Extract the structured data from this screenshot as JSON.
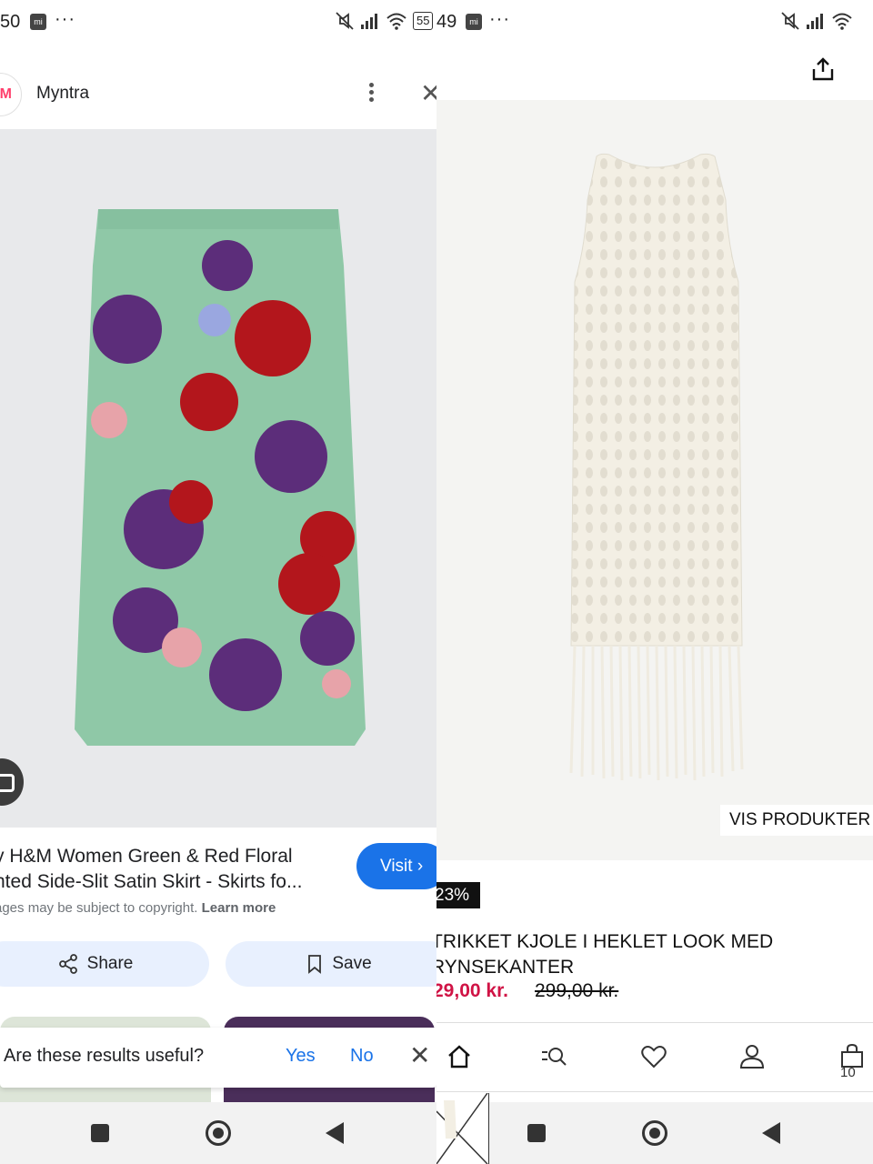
{
  "left": {
    "status": {
      "time": "50",
      "mi_badge": "mi",
      "dots": "···",
      "battery": "55"
    },
    "header": {
      "site_name": "Myntra",
      "site_logo": "M"
    },
    "result": {
      "title_line1": "y H&M Women Green & Red Floral",
      "title_line2": "nted Side-Slit Satin Skirt - Skirts fo...",
      "visit_label": "Visit",
      "copyright_text": "ages may be subject to copyright.",
      "learn_more": "Learn more"
    },
    "actions": {
      "share_label": "Share",
      "save_label": "Save"
    },
    "feedback": {
      "question": "Are these results useful?",
      "yes": "Yes",
      "no": "No"
    }
  },
  "right": {
    "status": {
      "time": "49",
      "mi_badge": "mi",
      "dots": "···"
    },
    "product": {
      "vis_button": "VIS PRODUKTER",
      "discount": "23%",
      "name_line1": "TRIKKET KJOLE I HEKLET LOOK MED",
      "name_line2": "RYNSEKANTER",
      "price_new": "29,00 kr.",
      "price_old": "299,00 kr."
    },
    "tabbar": {
      "bag_count": "10"
    }
  },
  "colors": {
    "google_blue": "#1a73e8",
    "pill_bg": "#e8f0fe",
    "sale_red": "#d01345",
    "myntra_pink": "#ff3f6c"
  },
  "icons": [
    "mute-icon",
    "signal-icon",
    "wifi-icon",
    "battery-icon",
    "kebab-icon",
    "close-icon",
    "lens-icon",
    "share-icon",
    "bookmark-icon",
    "home-icon",
    "search-filter-icon",
    "heart-icon",
    "user-icon",
    "bag-icon",
    "nav-recent-icon",
    "nav-home-icon",
    "nav-back-icon"
  ]
}
